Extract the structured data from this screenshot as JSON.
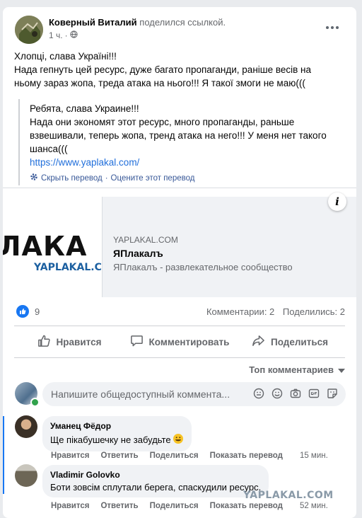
{
  "post": {
    "author": "Коверный Виталий",
    "action": "поделился ссылкой.",
    "time": "1 ч.",
    "privacy_icon": "globe-icon",
    "text_lines": [
      "Хлопці, слава Україні!!!",
      "Нада гепнуть цей ресурс, дуже багато пропаганди, раніше весів на",
      "ньому зараз жопа, треда атака на нього!!! Я такої змоги не маю((("
    ]
  },
  "translation": {
    "lines": [
      "Ребята, слава Украине!!!",
      "Нада они экономят этот ресурс, много пропаганды, раньше",
      "взвешивали, теперь жопа, тренд атака на него!!! У меня нет такого",
      "шанса((("
    ],
    "link": "https://www.yaplakal.com/",
    "hide_label": "Скрыть перевод",
    "separator": "·",
    "rate_label": "Оцените этот перевод"
  },
  "link_preview": {
    "image_text": "ЛАКА",
    "image_subtext": "YAPLAKAL.C",
    "domain": "YAPLAKAL.COM",
    "title": "ЯПлакалъ",
    "description": "ЯПлакалъ - развлекательное сообщество",
    "info_label": "i"
  },
  "stats": {
    "likes": "9",
    "comments": "Комментарии: 2",
    "shares": "Поделились: 2"
  },
  "actions": {
    "like": "Нравится",
    "comment": "Комментировать",
    "share": "Поделиться"
  },
  "comments_sort": "Топ комментариев",
  "comment_input": {
    "placeholder": "Напишите общедоступный коммента..."
  },
  "comments": [
    {
      "author": "Уманец Фёдор",
      "text": "Ще пікабушечку не забудьте",
      "like": "Нравится",
      "reply": "Ответить",
      "share": "Поделиться",
      "translate": "Показать перевод",
      "time": "15 мин."
    },
    {
      "author": "Vladimir Golovko",
      "text": "Боти зовсім сплутали берега, спаскудили ресурс.",
      "like": "Нравится",
      "reply": "Ответить",
      "share": "Поделиться",
      "translate": "Показать перевод",
      "time": "52 мин."
    }
  ],
  "watermark": "YAPLAKAL.COM",
  "colors": {
    "accent": "#1877f2",
    "link": "#216fdb",
    "muted": "#65676b",
    "online": "#31a24c"
  }
}
